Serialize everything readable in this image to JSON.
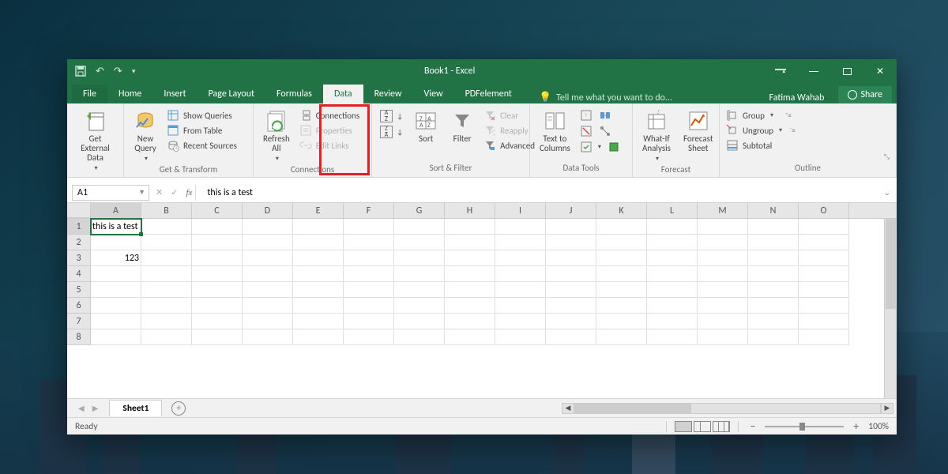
{
  "title": "Book1 - Excel",
  "quick_access": {
    "undo_tip": "Undo",
    "redo_tip": "Redo",
    "save_tip": "Save"
  },
  "tabs": {
    "file": "File",
    "home": "Home",
    "insert": "Insert",
    "page_layout": "Page Layout",
    "formulas": "Formulas",
    "data": "Data",
    "review": "Review",
    "view": "View",
    "pdf": "PDFelement",
    "active": "Data"
  },
  "tell_me": "Tell me what you want to do...",
  "user": "Fatima Wahab",
  "share": "Share",
  "ribbon": {
    "get_external": {
      "label": "Get External\nData",
      "group": ""
    },
    "get_transform": {
      "new_query": "New\nQuery",
      "show_queries": "Show Queries",
      "from_table": "From Table",
      "recent_sources": "Recent Sources",
      "group": "Get & Transform"
    },
    "connections": {
      "refresh_all": "Refresh\nAll",
      "connections": "Connections",
      "properties": "Properties",
      "edit_links": "Edit Links",
      "group": "Connections"
    },
    "sort_filter": {
      "sort": "Sort",
      "filter": "Filter",
      "clear": "Clear",
      "reapply": "Reapply",
      "advanced": "Advanced",
      "group": "Sort & Filter"
    },
    "data_tools": {
      "text_to_cols": "Text to\nColumns",
      "group": "Data Tools"
    },
    "forecast": {
      "what_if": "What-If\nAnalysis",
      "forecast_sheet": "Forecast\nSheet",
      "group": "Forecast"
    },
    "outline": {
      "group_btn": "Group",
      "ungroup": "Ungroup",
      "subtotal": "Subtotal",
      "group": "Outline"
    }
  },
  "name_box": "A1",
  "formula": "this is a test",
  "columns": [
    "A",
    "B",
    "C",
    "D",
    "E",
    "F",
    "G",
    "H",
    "I",
    "J",
    "K",
    "L",
    "M",
    "N",
    "O"
  ],
  "rows": [
    1,
    2,
    3,
    4,
    5,
    6,
    7,
    8
  ],
  "cells": {
    "A1": "this is a test",
    "A3": "123"
  },
  "selected_cell": "A1",
  "sheets": {
    "active": "Sheet1"
  },
  "status": "Ready",
  "zoom": "100%"
}
